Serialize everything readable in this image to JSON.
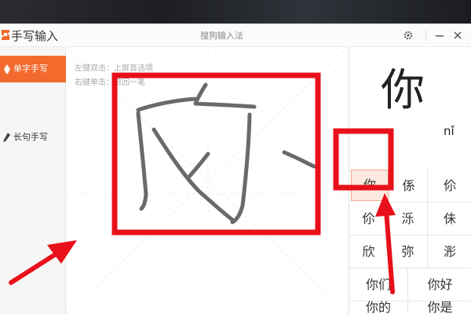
{
  "window": {
    "app_title": "手写输入",
    "center_title": "搜狗输入法",
    "brand_color": "#f26a2c"
  },
  "titlebar_icons": [
    "gear-icon",
    "minimize-icon",
    "close-icon"
  ],
  "sidebar": {
    "items": [
      {
        "label": "单字手写",
        "active": true
      },
      {
        "label": "长句手写",
        "active": false
      }
    ]
  },
  "canvas": {
    "hint_line1": "左键双击：上屏首选项",
    "hint_line2": "右键单击：退回一笔"
  },
  "candidates": {
    "preview_char": "你",
    "preview_pinyin": "nǐ",
    "grid": [
      [
        "你",
        "係",
        "伱"
      ],
      [
        "伱",
        "泺",
        "佅"
      ],
      [
        "欣",
        "弥",
        "浵"
      ]
    ],
    "phrases": [
      [
        "你们",
        "你好"
      ],
      [
        "你的",
        "你是"
      ]
    ]
  },
  "annotation": {
    "box_color": "#e8101a",
    "arrow_color": "#e8101a"
  }
}
